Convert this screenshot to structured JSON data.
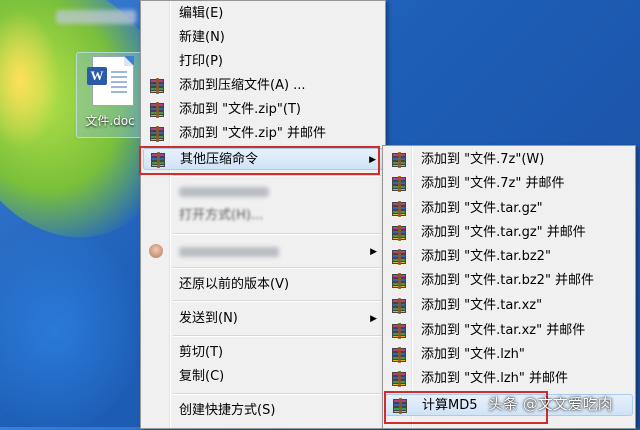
{
  "desktop": {
    "icon_label": "文件.doc"
  },
  "context_menu": {
    "items": [
      {
        "label": "编辑(E)"
      },
      {
        "label": "新建(N)"
      },
      {
        "label": "打印(P)"
      },
      {
        "label": "添加到压缩文件(A) ..."
      },
      {
        "label": "添加到 \"文件.zip\"(T)"
      },
      {
        "label": "添加到 \"文件.zip\" 并邮件"
      },
      {
        "label": "其他压缩命令",
        "has_submenu": true
      },
      {
        "label": "打开方式(H)..."
      },
      {
        "label": "还原以前的版本(V)"
      },
      {
        "label": "发送到(N)",
        "has_submenu": true
      },
      {
        "label": "剪切(T)"
      },
      {
        "label": "复制(C)"
      },
      {
        "label": "创建快捷方式(S)"
      }
    ]
  },
  "submenu": {
    "items": [
      {
        "label": "添加到 \"文件.7z\"(W)"
      },
      {
        "label": "添加到 \"文件.7z\" 并邮件"
      },
      {
        "label": "添加到 \"文件.tar.gz\""
      },
      {
        "label": "添加到 \"文件.tar.gz\" 并邮件"
      },
      {
        "label": "添加到 \"文件.tar.bz2\""
      },
      {
        "label": "添加到 \"文件.tar.bz2\" 并邮件"
      },
      {
        "label": "添加到 \"文件.tar.xz\""
      },
      {
        "label": "添加到 \"文件.tar.xz\" 并邮件"
      },
      {
        "label": "添加到 \"文件.lzh\""
      },
      {
        "label": "添加到 \"文件.lzh\" 并邮件"
      },
      {
        "label": "计算MD5"
      }
    ]
  },
  "watermark": "头条 @文文爱吃肉",
  "colors": {
    "highlight_box": "#d42b2b",
    "menu_bg": "#f0f0f0"
  }
}
